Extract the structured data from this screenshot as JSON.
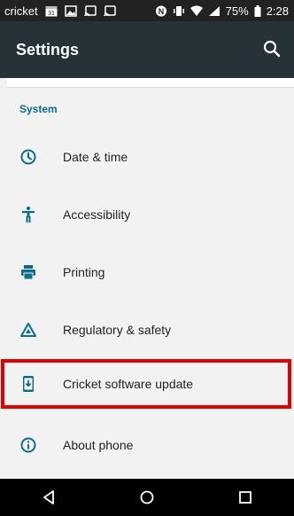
{
  "status_bar": {
    "carrier": "cricket",
    "calendar_day": "31",
    "battery_percent": "75%",
    "time": "2:28",
    "icons": [
      "calendar-icon",
      "image-icon",
      "cast-icon",
      "cast-icon",
      "nfc-icon",
      "vibrate-icon",
      "wifi-icon",
      "signal-icon",
      "battery-icon"
    ]
  },
  "app_bar": {
    "title": "Settings",
    "search_icon": "search-icon"
  },
  "section": {
    "title": "System"
  },
  "items": [
    {
      "label": "Date & time",
      "icon": "clock-icon"
    },
    {
      "label": "Accessibility",
      "icon": "accessibility-icon"
    },
    {
      "label": "Printing",
      "icon": "printer-icon"
    },
    {
      "label": "Regulatory & safety",
      "icon": "regulatory-icon"
    },
    {
      "label": "Cricket software update",
      "icon": "system-update-icon"
    },
    {
      "label": "About phone",
      "icon": "info-icon"
    }
  ],
  "nav_bar": {
    "icons": [
      "back-icon",
      "home-icon",
      "recents-icon"
    ]
  },
  "colors": {
    "app_bar": "#263238",
    "accent": "#0d6c8a",
    "highlight": "#e00000"
  }
}
